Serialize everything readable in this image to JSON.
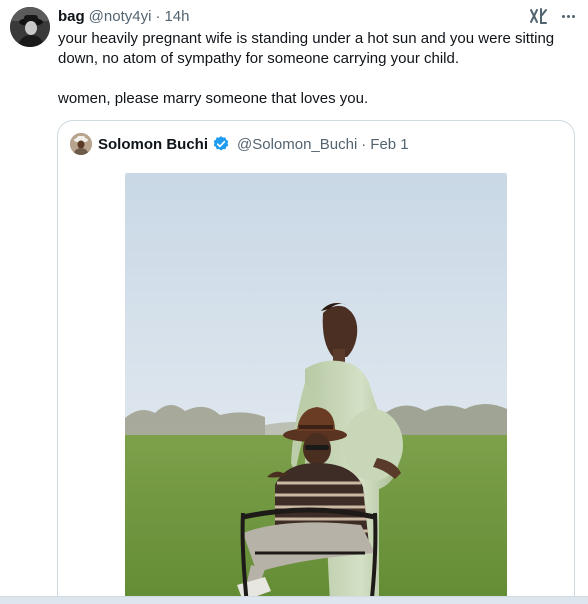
{
  "post": {
    "author_name": "bag",
    "author_handle": "@noty4yi",
    "separator": "·",
    "time": "14h",
    "text_line1": "your heavily pregnant wife is standing under a hot sun and you were sitting down, no atom of sympathy for someone carrying your child.",
    "text_line2": "women, please marry someone that loves you."
  },
  "quoted": {
    "author_name": "Solomon Buchi",
    "author_handle": "@Solomon_Buchi",
    "separator": "·",
    "date": "Feb 1",
    "verified": true,
    "image_subject": "pregnant woman in green dress standing behind seated man in brown hat on a grassy field"
  },
  "icons": {
    "grok": "grok-icon",
    "more": "more-options-icon",
    "verified": "verified-badge-icon"
  },
  "colors": {
    "text": "#0f1419",
    "secondary": "#536471",
    "border": "#cfd9de",
    "verified": "#1d9bf0"
  }
}
